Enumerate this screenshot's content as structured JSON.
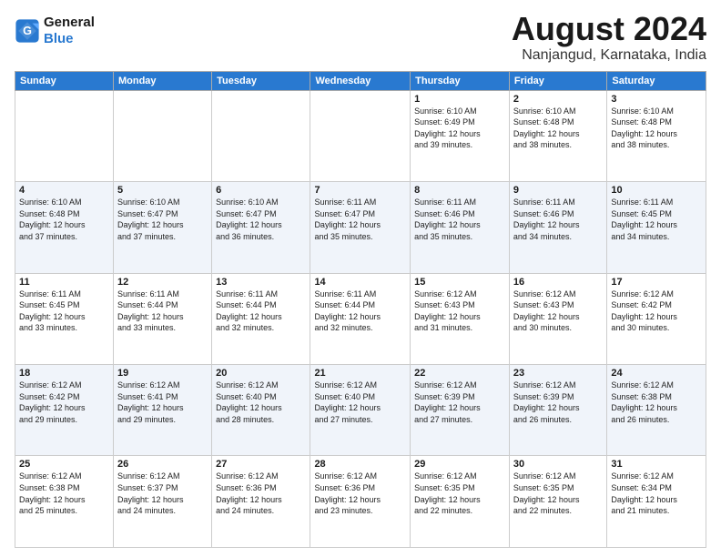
{
  "logo": {
    "line1": "General",
    "line2": "Blue"
  },
  "title": "August 2024",
  "subtitle": "Nanjangud, Karnataka, India",
  "days_header": [
    "Sunday",
    "Monday",
    "Tuesday",
    "Wednesday",
    "Thursday",
    "Friday",
    "Saturday"
  ],
  "weeks": [
    [
      {
        "num": "",
        "info": ""
      },
      {
        "num": "",
        "info": ""
      },
      {
        "num": "",
        "info": ""
      },
      {
        "num": "",
        "info": ""
      },
      {
        "num": "1",
        "info": "Sunrise: 6:10 AM\nSunset: 6:49 PM\nDaylight: 12 hours\nand 39 minutes."
      },
      {
        "num": "2",
        "info": "Sunrise: 6:10 AM\nSunset: 6:48 PM\nDaylight: 12 hours\nand 38 minutes."
      },
      {
        "num": "3",
        "info": "Sunrise: 6:10 AM\nSunset: 6:48 PM\nDaylight: 12 hours\nand 38 minutes."
      }
    ],
    [
      {
        "num": "4",
        "info": "Sunrise: 6:10 AM\nSunset: 6:48 PM\nDaylight: 12 hours\nand 37 minutes."
      },
      {
        "num": "5",
        "info": "Sunrise: 6:10 AM\nSunset: 6:47 PM\nDaylight: 12 hours\nand 37 minutes."
      },
      {
        "num": "6",
        "info": "Sunrise: 6:10 AM\nSunset: 6:47 PM\nDaylight: 12 hours\nand 36 minutes."
      },
      {
        "num": "7",
        "info": "Sunrise: 6:11 AM\nSunset: 6:47 PM\nDaylight: 12 hours\nand 35 minutes."
      },
      {
        "num": "8",
        "info": "Sunrise: 6:11 AM\nSunset: 6:46 PM\nDaylight: 12 hours\nand 35 minutes."
      },
      {
        "num": "9",
        "info": "Sunrise: 6:11 AM\nSunset: 6:46 PM\nDaylight: 12 hours\nand 34 minutes."
      },
      {
        "num": "10",
        "info": "Sunrise: 6:11 AM\nSunset: 6:45 PM\nDaylight: 12 hours\nand 34 minutes."
      }
    ],
    [
      {
        "num": "11",
        "info": "Sunrise: 6:11 AM\nSunset: 6:45 PM\nDaylight: 12 hours\nand 33 minutes."
      },
      {
        "num": "12",
        "info": "Sunrise: 6:11 AM\nSunset: 6:44 PM\nDaylight: 12 hours\nand 33 minutes."
      },
      {
        "num": "13",
        "info": "Sunrise: 6:11 AM\nSunset: 6:44 PM\nDaylight: 12 hours\nand 32 minutes."
      },
      {
        "num": "14",
        "info": "Sunrise: 6:11 AM\nSunset: 6:44 PM\nDaylight: 12 hours\nand 32 minutes."
      },
      {
        "num": "15",
        "info": "Sunrise: 6:12 AM\nSunset: 6:43 PM\nDaylight: 12 hours\nand 31 minutes."
      },
      {
        "num": "16",
        "info": "Sunrise: 6:12 AM\nSunset: 6:43 PM\nDaylight: 12 hours\nand 30 minutes."
      },
      {
        "num": "17",
        "info": "Sunrise: 6:12 AM\nSunset: 6:42 PM\nDaylight: 12 hours\nand 30 minutes."
      }
    ],
    [
      {
        "num": "18",
        "info": "Sunrise: 6:12 AM\nSunset: 6:42 PM\nDaylight: 12 hours\nand 29 minutes."
      },
      {
        "num": "19",
        "info": "Sunrise: 6:12 AM\nSunset: 6:41 PM\nDaylight: 12 hours\nand 29 minutes."
      },
      {
        "num": "20",
        "info": "Sunrise: 6:12 AM\nSunset: 6:40 PM\nDaylight: 12 hours\nand 28 minutes."
      },
      {
        "num": "21",
        "info": "Sunrise: 6:12 AM\nSunset: 6:40 PM\nDaylight: 12 hours\nand 27 minutes."
      },
      {
        "num": "22",
        "info": "Sunrise: 6:12 AM\nSunset: 6:39 PM\nDaylight: 12 hours\nand 27 minutes."
      },
      {
        "num": "23",
        "info": "Sunrise: 6:12 AM\nSunset: 6:39 PM\nDaylight: 12 hours\nand 26 minutes."
      },
      {
        "num": "24",
        "info": "Sunrise: 6:12 AM\nSunset: 6:38 PM\nDaylight: 12 hours\nand 26 minutes."
      }
    ],
    [
      {
        "num": "25",
        "info": "Sunrise: 6:12 AM\nSunset: 6:38 PM\nDaylight: 12 hours\nand 25 minutes."
      },
      {
        "num": "26",
        "info": "Sunrise: 6:12 AM\nSunset: 6:37 PM\nDaylight: 12 hours\nand 24 minutes."
      },
      {
        "num": "27",
        "info": "Sunrise: 6:12 AM\nSunset: 6:36 PM\nDaylight: 12 hours\nand 24 minutes."
      },
      {
        "num": "28",
        "info": "Sunrise: 6:12 AM\nSunset: 6:36 PM\nDaylight: 12 hours\nand 23 minutes."
      },
      {
        "num": "29",
        "info": "Sunrise: 6:12 AM\nSunset: 6:35 PM\nDaylight: 12 hours\nand 22 minutes."
      },
      {
        "num": "30",
        "info": "Sunrise: 6:12 AM\nSunset: 6:35 PM\nDaylight: 12 hours\nand 22 minutes."
      },
      {
        "num": "31",
        "info": "Sunrise: 6:12 AM\nSunset: 6:34 PM\nDaylight: 12 hours\nand 21 minutes."
      }
    ]
  ]
}
